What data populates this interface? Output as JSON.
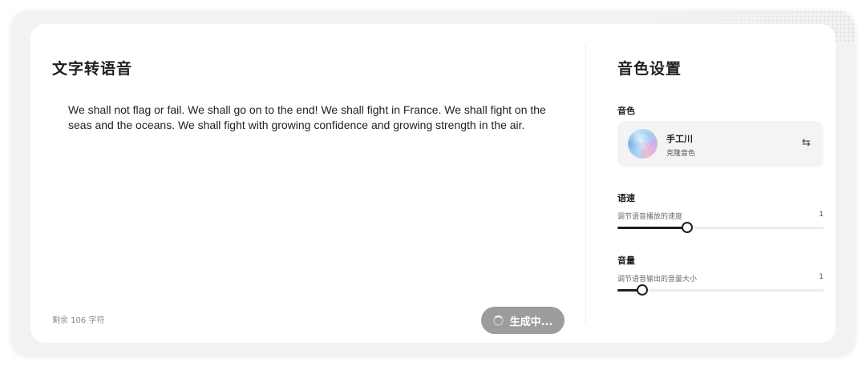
{
  "editor": {
    "title": "文字转语音",
    "text": "We shall not flag or fail. We shall go on to the end! We shall fight in France. We shall fight on the seas and the oceans. We shall fight with growing confidence and growing strength in the air.",
    "remaining": "剩余 106 字符",
    "generate_label": "生成中..."
  },
  "settings": {
    "title": "音色设置",
    "voice": {
      "section_label": "音色",
      "name": "手工川",
      "type": "克隆音色",
      "swap_icon": "⇆"
    },
    "speed": {
      "section_label": "语速",
      "description": "调节语音播放的速度",
      "value": "1",
      "level": 0.34
    },
    "volume": {
      "section_label": "音量",
      "description": "调节语音输出的音量大小",
      "value": "1",
      "level": 0.12
    }
  }
}
